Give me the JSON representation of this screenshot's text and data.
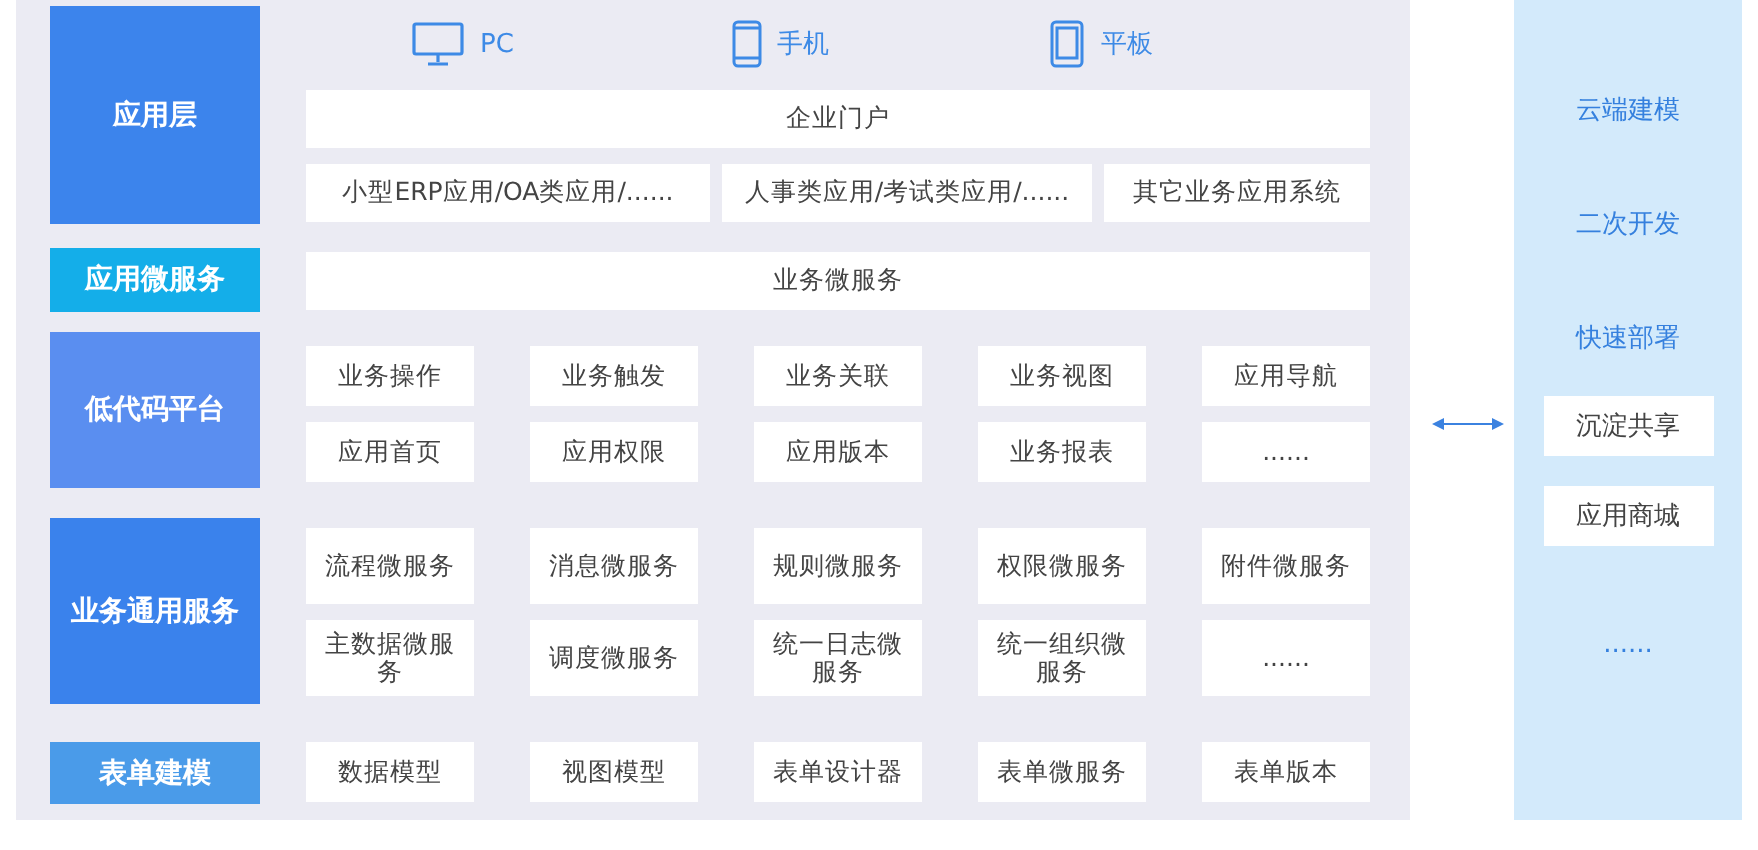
{
  "layers": [
    {
      "kind": "front",
      "label": "应用层",
      "color": "#3c84ec",
      "devices": [
        "PC",
        "手机",
        "平板"
      ],
      "portal": "企业门户",
      "rows": [
        [
          "小型ERP应用/OA类应用/......",
          "人事类应用/考试类应用/......",
          "其它业务应用系统"
        ]
      ]
    },
    {
      "kind": "bar",
      "label": "应用微服务",
      "color": "#14aee9",
      "rows": [
        [
          "业务微服务"
        ]
      ]
    },
    {
      "kind": "grid",
      "label": "低代码平台",
      "color": "#5a8ef0",
      "rows": [
        [
          "业务操作",
          "业务触发",
          "业务关联",
          "业务视图",
          "应用导航"
        ],
        [
          "应用首页",
          "应用权限",
          "应用版本",
          "业务报表",
          "......"
        ]
      ]
    },
    {
      "kind": "grid",
      "label": "业务通用服务",
      "color": "#3a82ec",
      "rows": [
        [
          "流程微服务",
          "消息微服务",
          "规则微服务",
          "权限微服务",
          "附件微服务"
        ],
        [
          "主数据微服务",
          "调度微服务",
          "统一日志微服务",
          "统一组织微服务",
          "......"
        ]
      ]
    },
    {
      "kind": "grid",
      "label": "表单建模",
      "color": "#4a9be9",
      "rows": [
        [
          "数据模型",
          "视图模型",
          "表单设计器",
          "表单微服务",
          "表单版本"
        ]
      ]
    }
  ],
  "side": [
    {
      "kind": "text",
      "label": "云端建模"
    },
    {
      "kind": "text",
      "label": "二次开发"
    },
    {
      "kind": "text",
      "label": "快速部署"
    },
    {
      "kind": "card",
      "label": "沉淀共享"
    },
    {
      "kind": "card",
      "label": "应用商城"
    },
    {
      "kind": "text",
      "label": "......"
    }
  ]
}
